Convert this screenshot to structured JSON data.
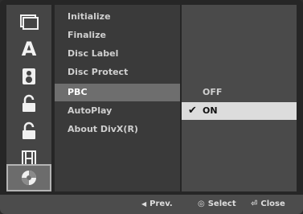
{
  "menu": {
    "items": [
      {
        "label": "Initialize"
      },
      {
        "label": "Finalize"
      },
      {
        "label": "Disc Label"
      },
      {
        "label": "Disc Protect"
      },
      {
        "label": "PBC"
      },
      {
        "label": "AutoPlay"
      },
      {
        "label": "About DivX(R)"
      }
    ],
    "selected_index": 4
  },
  "options": {
    "items": [
      {
        "label": "OFF"
      },
      {
        "label": "ON"
      }
    ],
    "current_index": 1
  },
  "icons": [
    {
      "name": "picture-icon"
    },
    {
      "name": "language-icon",
      "glyph": "A"
    },
    {
      "name": "audio-icon"
    },
    {
      "name": "lock-icon"
    },
    {
      "name": "lock-icon"
    },
    {
      "name": "filmstrip-icon"
    },
    {
      "name": "disc-icon"
    }
  ],
  "bottom": {
    "prev": {
      "glyph": "◀",
      "label": "Prev."
    },
    "select": {
      "glyph": "◎",
      "label": "Select"
    },
    "close": {
      "glyph": "⏎",
      "label": "Close"
    }
  }
}
